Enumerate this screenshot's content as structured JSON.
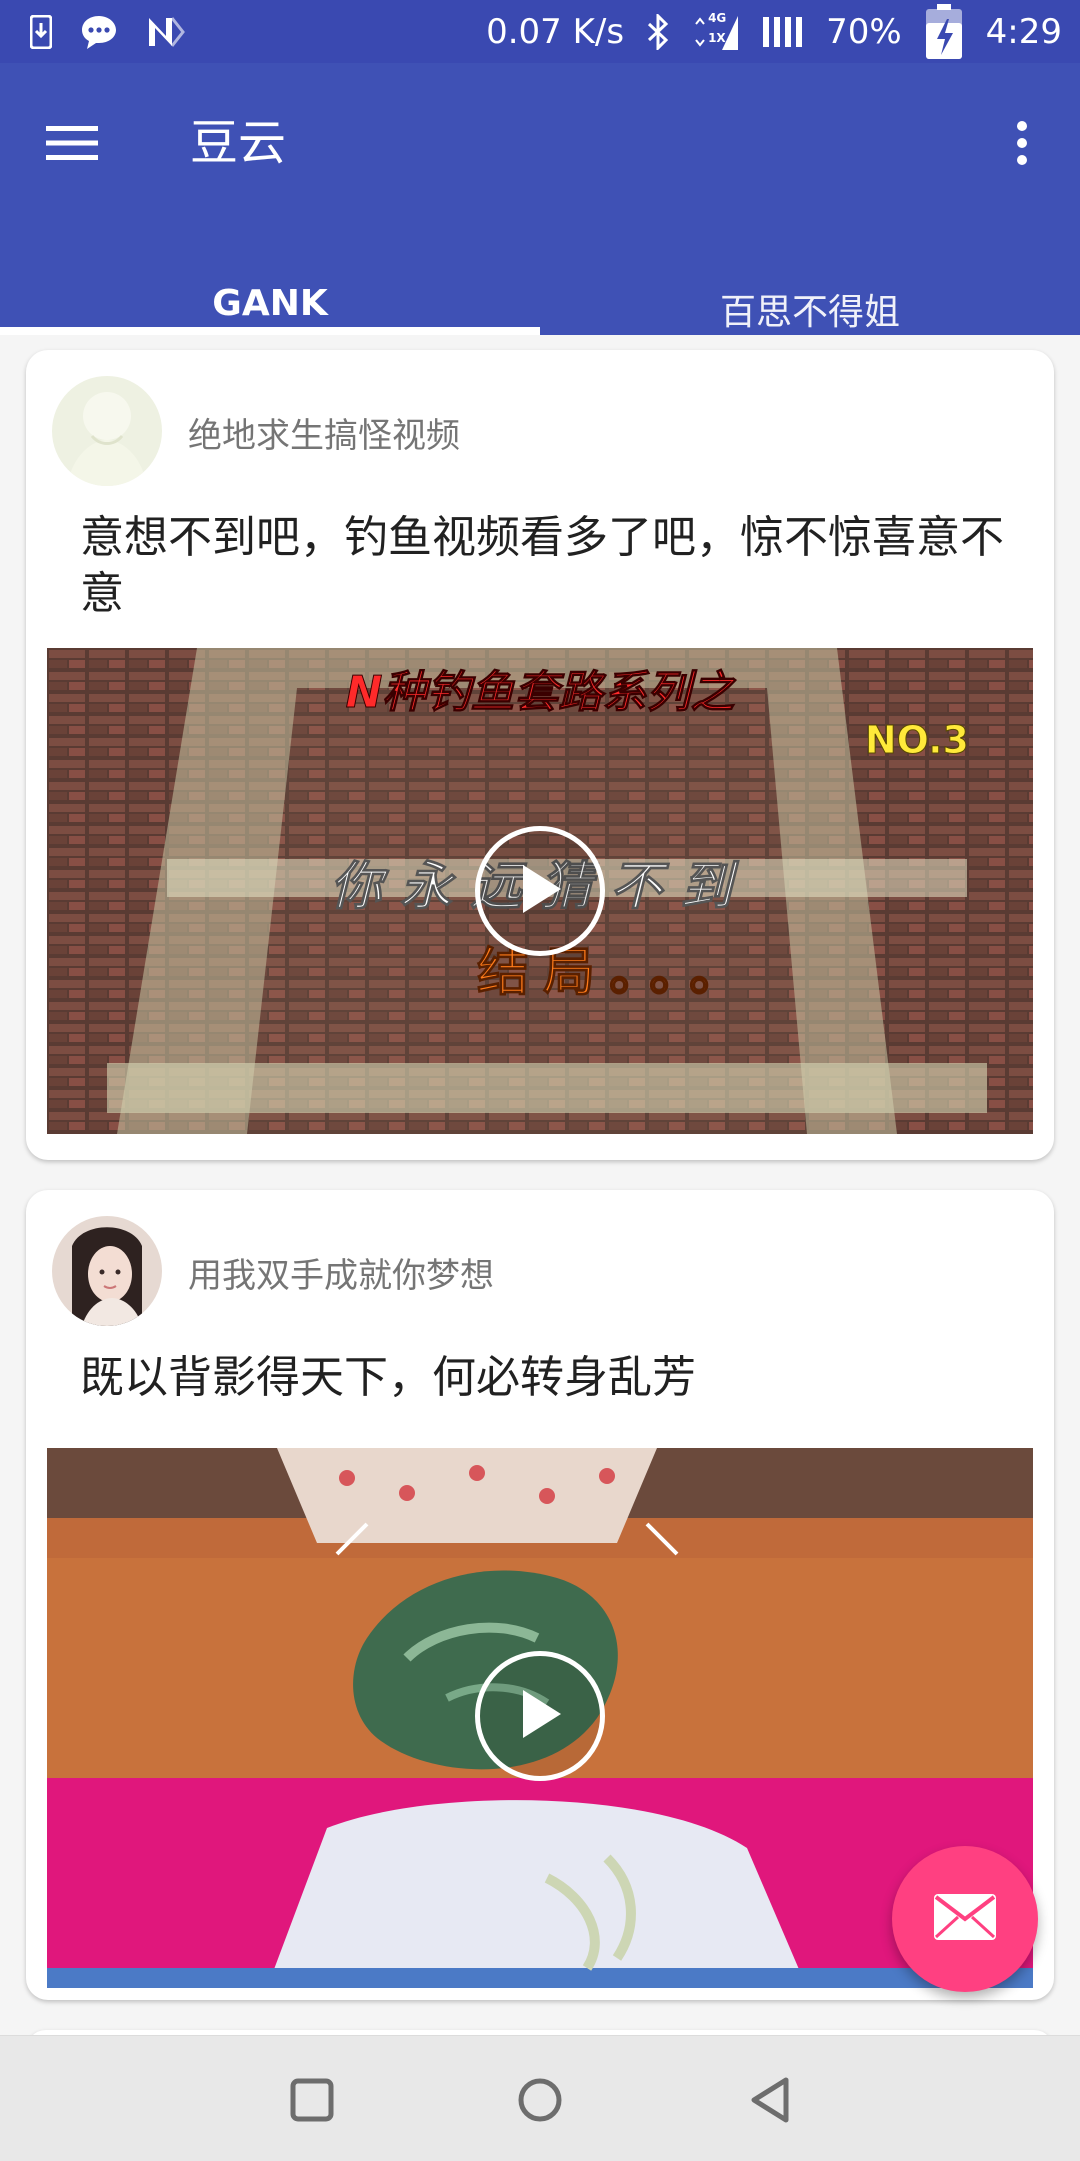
{
  "status_bar": {
    "net_speed": "0.07 K/s",
    "battery": "70%",
    "time": "4:29",
    "icons": [
      "download-icon",
      "chat-bubble-icon",
      "n-logo-icon",
      "bluetooth-icon",
      "lte-4g-icon",
      "signal-icon",
      "battery-charging-icon"
    ],
    "lte_top": "4G",
    "lte_bottom": "1X"
  },
  "app_bar": {
    "title": "豆云",
    "menu_icon": "hamburger-menu-icon",
    "more_icon": "more-vertical-icon",
    "tabs": [
      {
        "label": "GANK",
        "active": true
      },
      {
        "label": "百思不得姐",
        "active": false
      }
    ]
  },
  "colors": {
    "primary": "#3f51b5",
    "primary_dark": "#3a49b1",
    "accent": "#ff4081"
  },
  "feed": {
    "posts": [
      {
        "author": "绝地求生搞怪视频",
        "caption": "意想不到吧，钓鱼视频看多了吧，惊不惊喜意不意",
        "video_overlay": {
          "line1": "N种钓鱼套路系列之",
          "line2": "NO.3",
          "line3": "你永远猜不到",
          "line4": "结局。。。"
        }
      },
      {
        "author": "用我双手成就你梦想",
        "caption": "既以背影得天下，何必转身乱芳"
      }
    ]
  },
  "fab": {
    "icon": "mail-icon"
  },
  "nav_bar": {
    "icons": [
      "recents-square-icon",
      "home-circle-icon",
      "back-triangle-icon"
    ]
  }
}
